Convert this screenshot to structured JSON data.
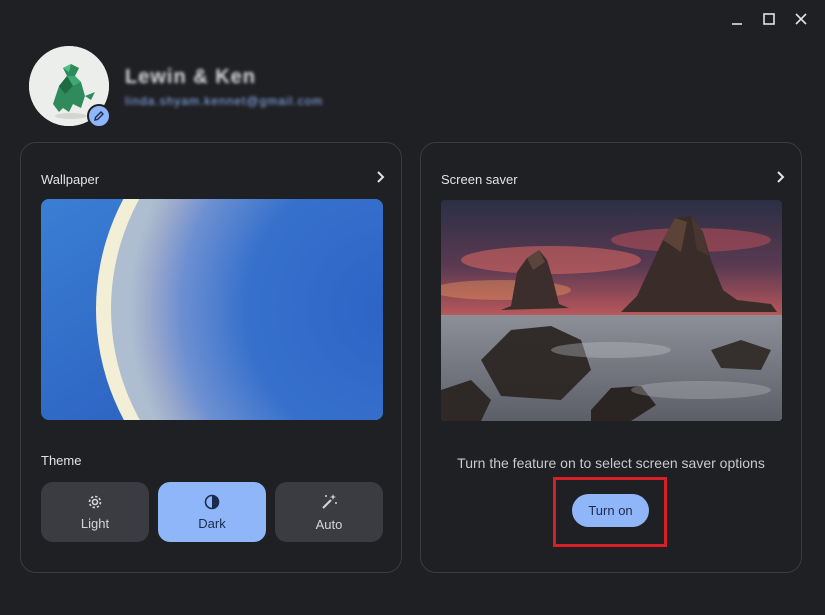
{
  "window": {
    "controls": [
      "minimize",
      "maximize",
      "close"
    ]
  },
  "profile": {
    "name": "Lewin & Ken",
    "email": "linda.shyam.kennet@gmail.com"
  },
  "wallpaper": {
    "title": "Wallpaper",
    "theme_label": "Theme",
    "themes": [
      {
        "label": "Light",
        "icon": "gear-icon",
        "selected": false
      },
      {
        "label": "Dark",
        "icon": "half-circle-icon",
        "selected": true
      },
      {
        "label": "Auto",
        "icon": "magic-wand-icon",
        "selected": false
      }
    ]
  },
  "screen_saver": {
    "title": "Screen saver",
    "message": "Turn the feature on to select screen saver options",
    "button_label": "Turn on"
  },
  "colors": {
    "accent": "#8fb6f8",
    "highlight": "#d81f26",
    "background": "#1f2024"
  }
}
